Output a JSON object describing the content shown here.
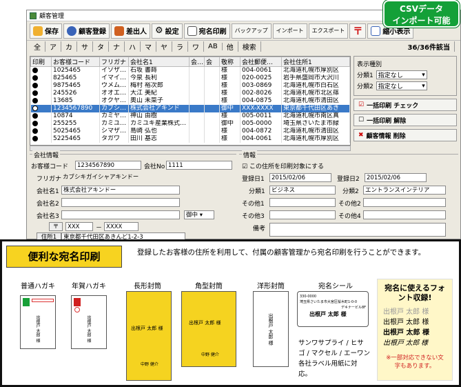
{
  "app": {
    "title": "顧客管理"
  },
  "badge": {
    "line1": "CSVデータ",
    "line2": "インポート可能"
  },
  "toolbar": {
    "save": "保存",
    "customer_reg": "顧客登録",
    "sender": "差出人",
    "settings": "設定",
    "label_print": "宛名印刷",
    "backup": "バックアップ",
    "import": "インポート",
    "export": "エクスポート",
    "shrink": "縮小表示"
  },
  "kana": [
    "全",
    "ア",
    "カ",
    "サ",
    "タ",
    "ナ",
    "ハ",
    "マ",
    "ヤ",
    "ラ",
    "ワ",
    "AB",
    "他",
    "検索"
  ],
  "count": "36/36件該当",
  "grid": {
    "headers": [
      "印刷",
      "お客様コード",
      "フリガナ",
      "会社名1",
      "会…",
      "会",
      "敬称",
      "会社郵便…",
      "会社住所1"
    ],
    "rows": [
      [
        "1025465",
        "イソザ…",
        "石坂 書蒔",
        "",
        "",
        "様",
        "004-0061",
        "北海道札幌市厚別区"
      ],
      [
        "825465",
        "イマイ…",
        "今泉 長利",
        "",
        "",
        "様",
        "020-0025",
        "岩手県盛岡市大沢川"
      ],
      [
        "9875465",
        "ウメム…",
        "梅村 裕次郎",
        "",
        "",
        "様",
        "003-0869",
        "北海道札幌市白石区"
      ],
      [
        "245526",
        "オオエ…",
        "大江 美紀",
        "",
        "",
        "様",
        "002-8026",
        "北海道札幌市北区篠"
      ],
      [
        "13685",
        "オクヤ…",
        "奥山 未菜子",
        "",
        "",
        "様",
        "004-0875",
        "北海道札幌市清田区"
      ],
      [
        "1234567890",
        "カブシ…",
        "株式会社アキンド",
        "",
        "",
        "御中",
        "XXX-XXXX",
        "東京都千代田区あき"
      ],
      [
        "10874",
        "カミヤ…",
        "神山 由樹",
        "",
        "",
        "様",
        "005-0011",
        "北海道札幌市南区真"
      ],
      [
        "255255",
        "カミユ…",
        "カミユキ産業株式…",
        "",
        "",
        "御中",
        "005-0000",
        "埼玉県さいたま市緑"
      ],
      [
        "5025465",
        "シマザ…",
        "島崎 弘也",
        "",
        "",
        "様",
        "004-0872",
        "北海道札幌市清田区"
      ],
      [
        "5225465",
        "タガワ",
        "田川 基志",
        "",
        "",
        "様",
        "004-0061",
        "北海道札幌市厚別区"
      ]
    ]
  },
  "display": {
    "legend": "表示種別",
    "cls1": "分類1",
    "cls2": "分類2",
    "opt": "指定なし"
  },
  "rbuttons": {
    "bulk_print": "一括印刷 チェック",
    "bulk_clear": "一括印刷 解除",
    "delete": "顧客情報 削除"
  },
  "company": {
    "legend": "会社情報",
    "code_l": "お客様コード",
    "code": "1234567890",
    "no_l": "会社No",
    "no": "1111",
    "furi_l": "フリガナ",
    "furi": "カブシキガイシャアキンドー",
    "name1_l": "会社名1",
    "name1": "株式会社アキンドー",
    "name2_l": "会社名2",
    "name3_l": "会社名3",
    "honor": "御中",
    "zip_l": "〒",
    "zip1": "XXX",
    "zip_dash": "－",
    "zip2": "XXXX",
    "addr_l": "住所1",
    "addr": "東京都千代田区あきんど1-2-3"
  },
  "info": {
    "legend": "情報",
    "check": "この住所を印刷対象にする",
    "reg1_l": "登録日1",
    "reg1": "2015/02/06",
    "reg2_l": "登録日2",
    "reg2": "2015/02/06",
    "c1_l": "分類1",
    "c1": "ビジネス",
    "c2_l": "分類2",
    "c2": "エントランスインテリア",
    "o1": "その他1",
    "o2": "その他2",
    "o3": "その他3",
    "o4": "その他4",
    "memo": "備考"
  },
  "banner": {
    "title": "便利な宛名印刷",
    "desc": "登録したお客様の住所を利用して、付属の顧客管理から宛名印刷を行うことができます。",
    "cards": [
      "普通ハガキ",
      "年賀ハガキ",
      "長形封筒",
      "角型封筒",
      "洋形封筒",
      "宛名シール"
    ],
    "label_note": "サンワサプライ / ヒサゴ / マクセル / エーワン各社ラベル用紙に対応。",
    "seal_lines": [
      "330-0000",
      "埼玉県さいたま市大宮区桜木町1-0-0",
      "デキナービル8F",
      "出根戸 太郎 様"
    ],
    "font_title": "宛名に使えるフォント収録!",
    "font_samples": [
      "出根戸 太郎 様",
      "出根戸 太郎 様",
      "出根戸 太郎 様",
      "出根戸 太郎 様"
    ],
    "font_note": "※一部対応できない文字もあります。",
    "env_name": "出根戸 太郎 様",
    "env_sender": "中野 健介"
  }
}
